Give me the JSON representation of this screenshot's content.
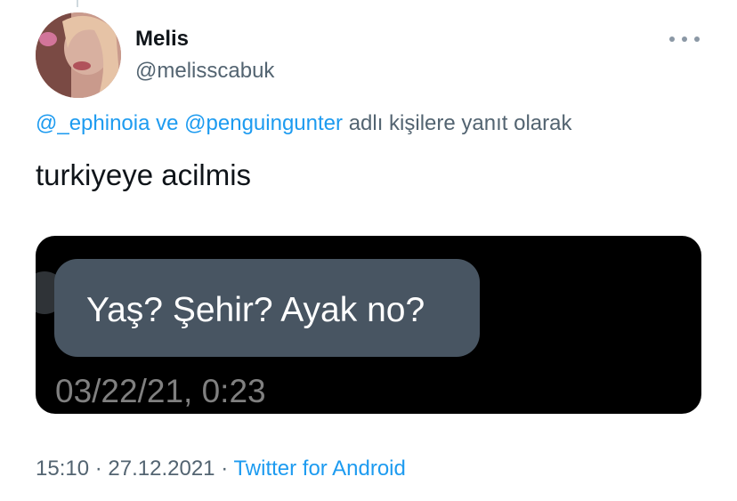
{
  "author": {
    "name": "Melis",
    "handle": "@melisscabuk"
  },
  "reply_context": {
    "mention_1": "@_ephinoia",
    "conjunction": "ve",
    "mention_2": "@penguingunter",
    "suffix": "adlı kişilere yanıt olarak"
  },
  "tweet": {
    "text": "turkiyeye acilmis"
  },
  "media": {
    "message_text": "Yaş? Şehir? Ayak no?",
    "message_time": "03/22/21, 0:23"
  },
  "meta": {
    "time": "15:10",
    "separator": "·",
    "date": "27.12.2021",
    "source": "Twitter for Android"
  },
  "colors": {
    "link": "#1d9bf0",
    "secondary_text": "#536471",
    "bubble": "#485562"
  },
  "icons": {
    "more": "more-horizontal-icon"
  }
}
